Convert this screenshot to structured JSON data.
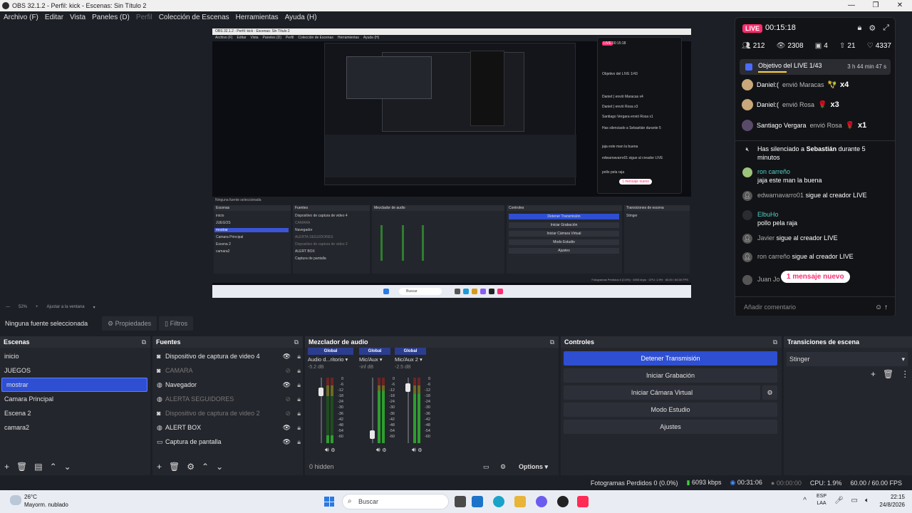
{
  "window": {
    "title": "OBS 32.1.2 - Perfil: kick - Escenas: Sin Título 2"
  },
  "menu": [
    {
      "label": "Archivo (F)",
      "enabled": true
    },
    {
      "label": "Editar",
      "enabled": true
    },
    {
      "label": "Vista",
      "enabled": true
    },
    {
      "label": "Paneles (D)",
      "enabled": true
    },
    {
      "label": "Perfil",
      "enabled": false
    },
    {
      "label": "Colección de Escenas",
      "enabled": true
    },
    {
      "label": "Herramientas",
      "enabled": true
    },
    {
      "label": "Ayuda (H)",
      "enabled": true
    }
  ],
  "zoom": {
    "value": "52%",
    "fit": "Ajustar a la ventana"
  },
  "chat": {
    "live_badge": "LIVE",
    "time": "00:15:18",
    "stats": {
      "viewers": "212",
      "views": "2308",
      "gifts": "4",
      "shares": "21",
      "likes": "4337"
    },
    "goal": {
      "label": "Objetivo del LIVE 1/43",
      "remaining": "3 h 44 min 47 s"
    },
    "gifts": [
      {
        "user": "Daniel:(",
        "action": "envió Maracas",
        "qty": "x4",
        "emoji": "🪇"
      },
      {
        "user": "Daniel:(",
        "action": "envió Rosa",
        "qty": "x3",
        "emoji": "🌹"
      },
      {
        "user": "Santiago Vergara",
        "action": "envió Rosa",
        "qty": "x1",
        "emoji": "🌹"
      }
    ],
    "system_msg": {
      "prefix": "Has silenciado a",
      "user": "Sebastián",
      "suffix": "durante 5 minutos"
    },
    "messages": [
      {
        "user": "ron carreño",
        "text": "jaja este man la buena"
      },
      {
        "user": "edwarnavarro01",
        "text": "sigue al creador LIVE"
      },
      {
        "user": "ElbuHo",
        "text": "pollo pela raja"
      },
      {
        "user": "Javier",
        "text": "sigue al creador LIVE"
      },
      {
        "user": "ron carreño",
        "text": "sigue al creador LIVE"
      },
      {
        "user": "Juan Jo",
        "text": ""
      }
    ],
    "new_messages": "1 mensaje nuevo",
    "comment_placeholder": "Añadir comentario"
  },
  "propbar": {
    "no_source": "Ninguna fuente seleccionada",
    "properties": "Propiedades",
    "filters": "Filtros"
  },
  "scenes": {
    "title": "Escenas",
    "items": [
      "inicio",
      "JUEGOS",
      "mostrar",
      "Camara Principal",
      "Escena 2",
      "camara2"
    ],
    "selected": "mostrar"
  },
  "sources": {
    "title": "Fuentes",
    "items": [
      {
        "label": "Dispositivo de captura de video 4",
        "icon": "camera-icon",
        "visible": true
      },
      {
        "label": "CAMARA",
        "icon": "camera-icon",
        "visible": false
      },
      {
        "label": "Navegador",
        "icon": "globe-icon",
        "visible": true
      },
      {
        "label": "ALERTA SEGUIDORES",
        "icon": "globe-icon",
        "visible": false
      },
      {
        "label": "Dispositivo de captura de video 2",
        "icon": "camera-icon",
        "visible": false
      },
      {
        "label": "ALERT BOX",
        "icon": "globe-icon",
        "visible": true
      },
      {
        "label": "Captura de pantalla",
        "icon": "monitor-icon",
        "visible": true
      }
    ]
  },
  "mixer": {
    "title": "Mezclador de audio",
    "channels": [
      {
        "group": "Global",
        "device": "Audio d...ritorio",
        "db": "-5.2 dB",
        "level": 0.12,
        "fader": 0.82
      },
      {
        "group": "Global",
        "device": "Mic/Aux",
        "db": "-inf dB",
        "level": 0.8,
        "fader": 0.08
      },
      {
        "group": "Global",
        "device": "Mic/Aux 2",
        "db": "-2.5 dB",
        "level": 0.75,
        "fader": 0.9
      }
    ],
    "scale": [
      "0",
      "-6",
      "-12",
      "-18",
      "-24",
      "-30",
      "-36",
      "-42",
      "-48",
      "-54",
      "-60"
    ],
    "hidden": "0 hidden",
    "options": "Options"
  },
  "controls": {
    "title": "Controles",
    "stop_stream": "Detener Transmisión",
    "start_recording": "Iniciar Grabación",
    "start_virtual_cam": "Iniciar Cámara Virtual",
    "studio_mode": "Modo Estudio",
    "settings": "Ajustes"
  },
  "transitions": {
    "title": "Transiciones de escena",
    "selected": "Stinger"
  },
  "status": {
    "dropped": "Fotogramas Perdidos 0 (0.0%)",
    "bitrate": "6093 kbps",
    "stream_time": "00:31:06",
    "rec_time": "00:00:00",
    "cpu": "CPU: 1.9%",
    "fps": "60.00 / 60.00 FPS"
  },
  "taskbar": {
    "weather_temp": "26°C",
    "weather_desc": "Mayorm. nublado",
    "search": "Buscar",
    "lang_top": "ESP",
    "lang_bottom": "LAA",
    "time": "22:15",
    "date": "24/8/2026"
  },
  "colors": {
    "accent": "#2e4fd1",
    "live": "#ff2d6f",
    "bg": "#1d1f26",
    "panel": "#24262d"
  }
}
